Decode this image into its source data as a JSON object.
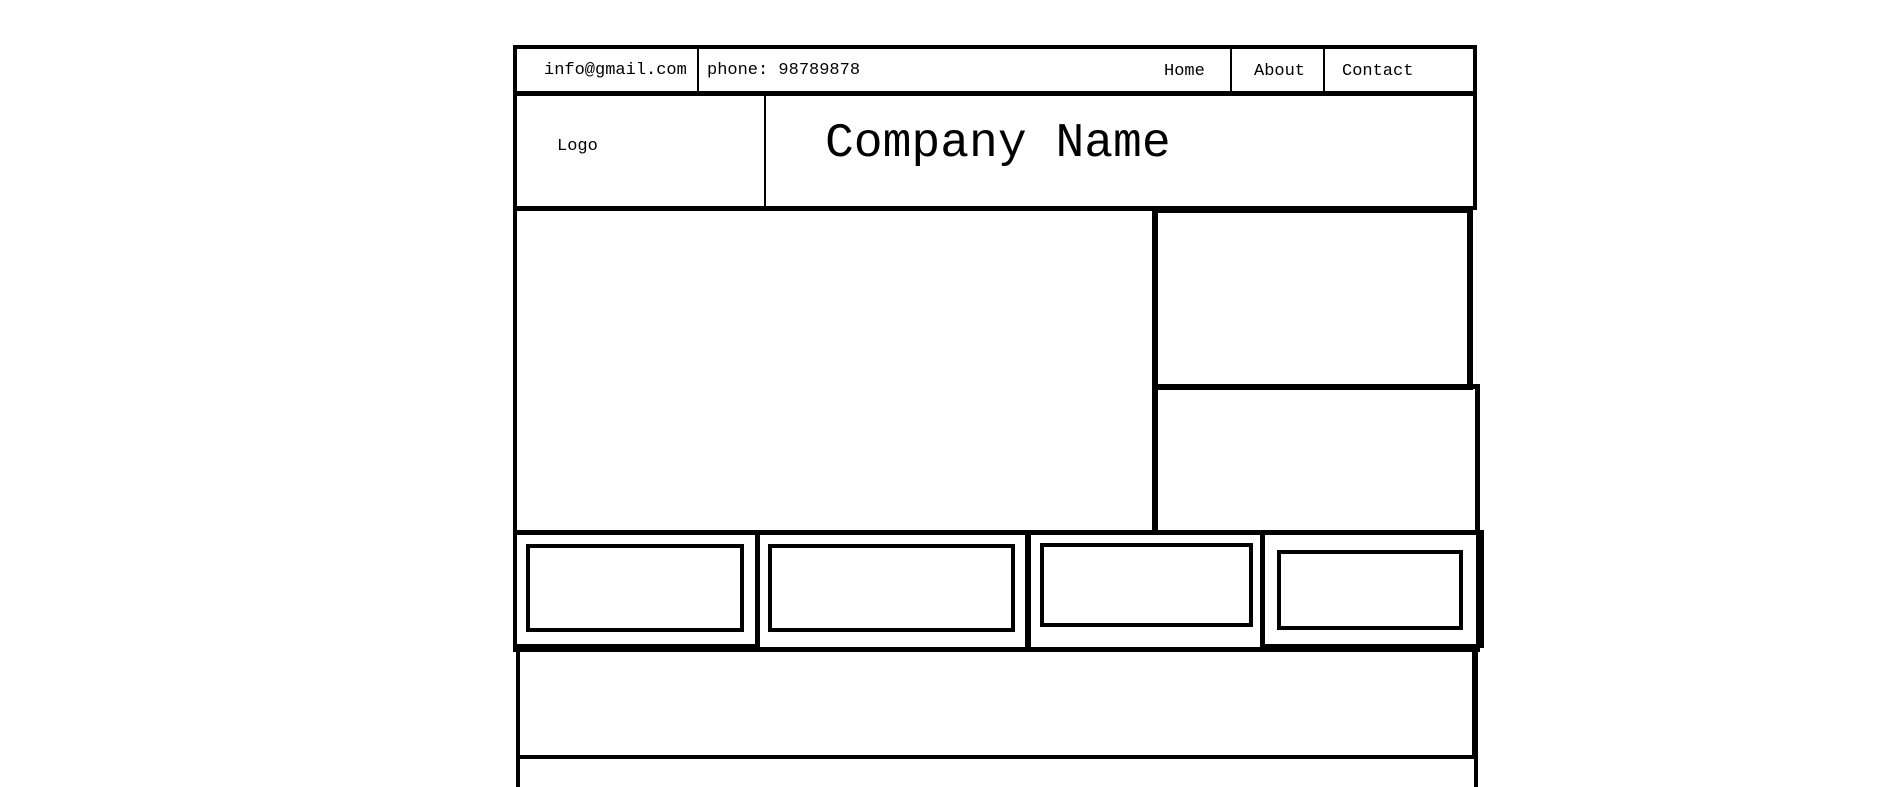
{
  "topbar": {
    "email": "info@gmail.com",
    "phone": "phone: 98789878",
    "nav": [
      {
        "label": "Home"
      },
      {
        "label": "About"
      },
      {
        "label": "Contact"
      }
    ]
  },
  "header": {
    "logo": "Logo",
    "company_name": "Company Name"
  }
}
